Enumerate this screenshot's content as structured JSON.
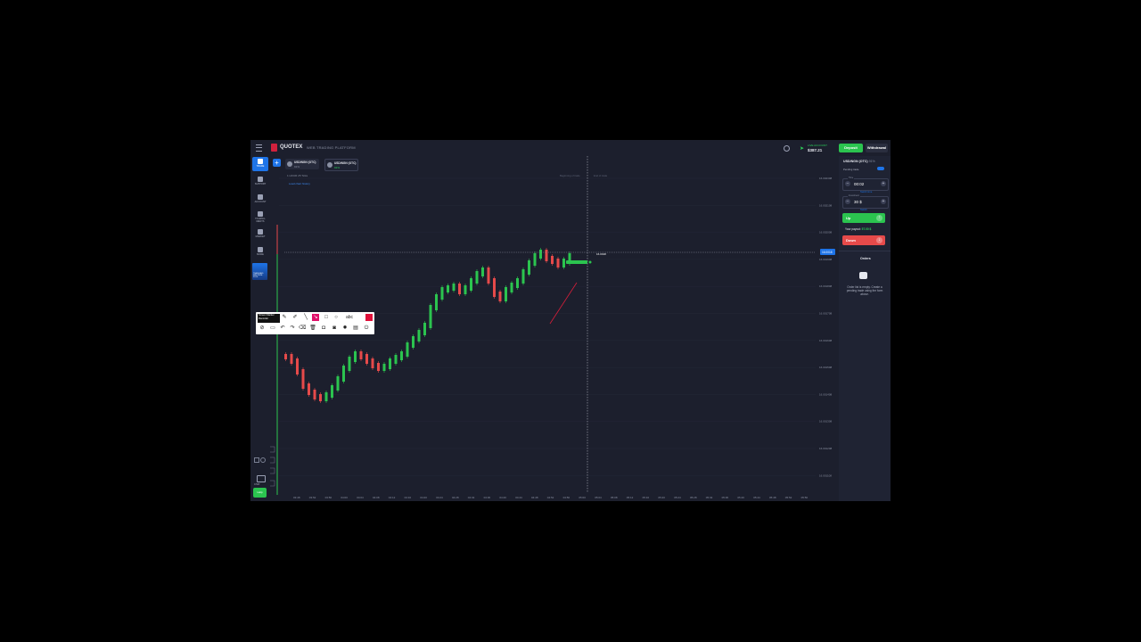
{
  "app": {
    "brand": "QUOTEX",
    "platform": "WEB TRADING PLATFORM",
    "account_label": "LIVE ACCOUNT",
    "balance": "$387.21",
    "deposit_label": "Deposit",
    "withdraw_label": "Withdrawal"
  },
  "sidebar": {
    "items": [
      {
        "label": "TRADE"
      },
      {
        "label": "SUPPORT"
      },
      {
        "label": "ACCOUNT"
      },
      {
        "label": "TOURNA-MENTS"
      },
      {
        "label": "MARKET"
      },
      {
        "label": "MORE"
      }
    ],
    "promo_text": "TRADE AND WIN PRIZE POOL",
    "chat_label": "CHAT",
    "help_label": "Help"
  },
  "tabs": [
    {
      "name": "USD/NGN (OTC)",
      "percent": "91%"
    },
    {
      "name": "USD/NGN (OTC)",
      "percent": "91%"
    }
  ],
  "chart": {
    "info": "1 HOUR 25 Ticks",
    "info2": "Load chart history",
    "beginning_label": "Beginning of trade",
    "end_label": "End of trade",
    "y_ticks": [
      "16.002308",
      "16.002108",
      "16.002008",
      "16.001908",
      "16.001808",
      "16.001708",
      "16.001608",
      "16.001508",
      "16.001408",
      "16.001308",
      "16.001208",
      "16.001108"
    ],
    "x_ticks": [
      "03:48",
      "03:52",
      "03:56",
      "04:00",
      "04:04",
      "04:08",
      "04:12",
      "04:16",
      "04:20",
      "04:24",
      "04:28",
      "04:32",
      "04:36",
      "04:40",
      "04:44",
      "04:48",
      "04:52",
      "04:56",
      "05:00",
      "05:04",
      "05:08",
      "05:12",
      "05:16",
      "05:20",
      "05:24",
      "05:28",
      "05:32",
      "05:36",
      "05:40",
      "05:44",
      "05:48",
      "05:52",
      "05:56"
    ],
    "price_tag": "16.0018",
    "current_price_label": "16.0018"
  },
  "draw_toolbar": {
    "brand": "Screen Marker Recorder",
    "abc": "abc"
  },
  "panel": {
    "asset": "USD/NGN (OTC)",
    "percent": "91%",
    "pending_trade": "Pending trade",
    "time_legend": "Time",
    "time_value": "00:02",
    "time_sub": "Switch time",
    "amount_legend": "Investment",
    "amount_value": "30 $",
    "amount_sub": "Switch",
    "up_label": "Up",
    "payout_label": "Your payout:",
    "payout_value": "57.00 $",
    "down_label": "Down",
    "orders_title": "Orders",
    "orders_empty": "Order list is empty. Create a pending trade using the form above."
  },
  "colors": {
    "bg": "#1c1f2d",
    "up": "#2bc44f",
    "down": "#e64a4a",
    "accent": "#1e74e8"
  }
}
